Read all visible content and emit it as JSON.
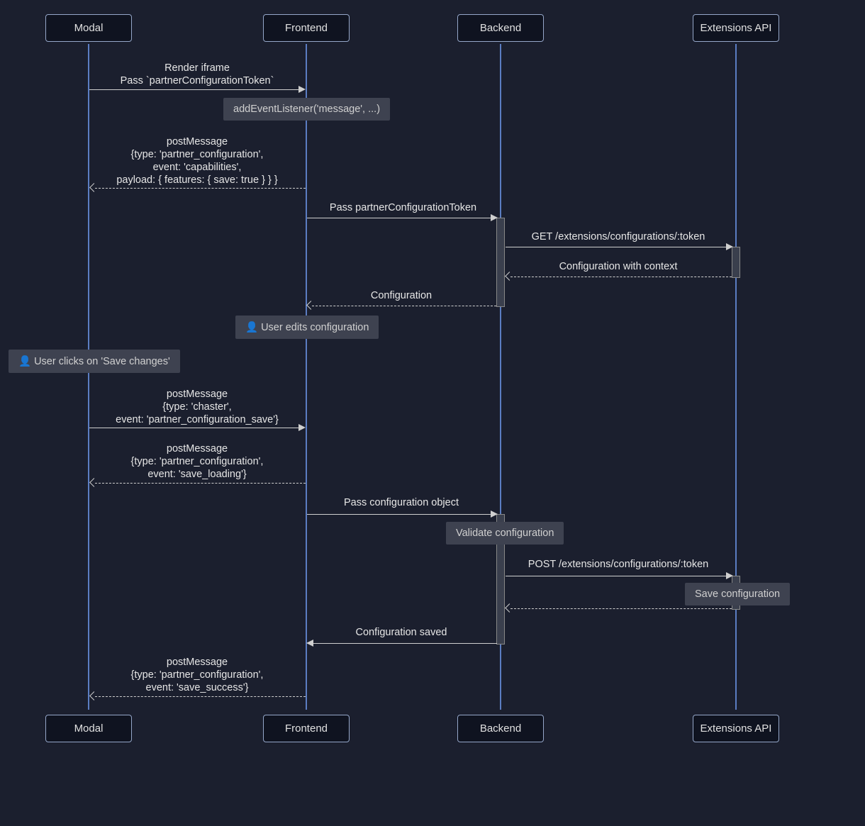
{
  "actors": {
    "modal": "Modal",
    "frontend": "Frontend",
    "backend": "Backend",
    "extensions": "Extensions API"
  },
  "messages": {
    "m1a": "Render iframe",
    "m1b": "Pass `partnerConfigurationToken`",
    "n1": "addEventListener('message', ...)",
    "m2a": "postMessage",
    "m2b": "{type: 'partner_configuration',",
    "m2c": "event: 'capabilities',",
    "m2d": "payload: { features: { save: true } } }",
    "m3": "Pass partnerConfigurationToken",
    "m4": "GET /extensions/configurations/:token",
    "m5": "Configuration with context",
    "m6": "Configuration",
    "n2": "User edits configuration",
    "n3": "User clicks on 'Save changes'",
    "m7a": "postMessage",
    "m7b": "{type: 'chaster',",
    "m7c": "event: 'partner_configuration_save'}",
    "m8a": "postMessage",
    "m8b": "{type: 'partner_configuration',",
    "m8c": "event: 'save_loading'}",
    "m9": "Pass configuration object",
    "n4": "Validate configuration",
    "m10": "POST /extensions/configurations/:token",
    "n5": "Save configuration",
    "m11_blank": "",
    "m12": "Configuration saved",
    "m13a": "postMessage",
    "m13b": "{type: 'partner_configuration',",
    "m13c": "event: 'save_success'}"
  },
  "icons": {
    "user": "👤"
  }
}
